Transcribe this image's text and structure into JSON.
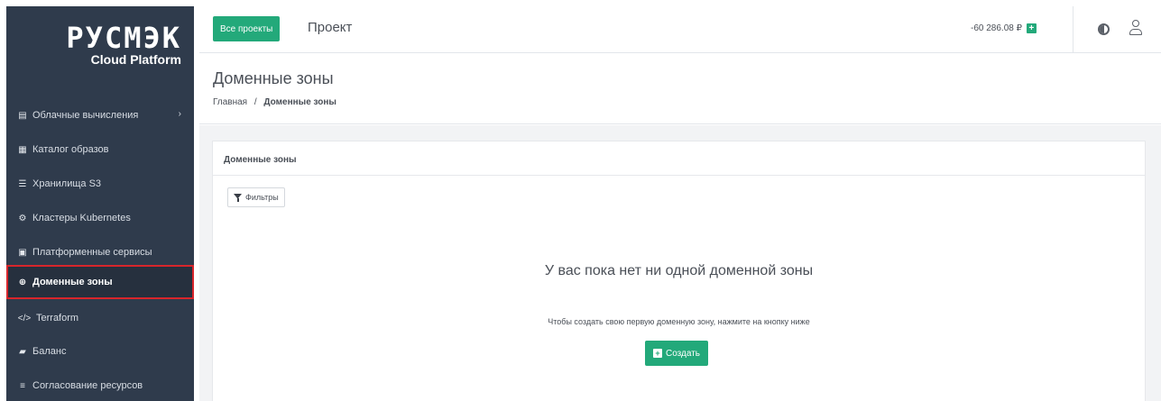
{
  "logo": {
    "main": "РУСМЭК",
    "sub": "Cloud Platform"
  },
  "sidebar": {
    "items": [
      {
        "label": "Облачные вычисления",
        "icon": "server-icon",
        "glyph": "▤",
        "has_arrow": true
      },
      {
        "label": "Каталог образов",
        "icon": "grid-icon",
        "glyph": "▦"
      },
      {
        "label": "Хранилища S3",
        "icon": "database-icon",
        "glyph": "☰"
      },
      {
        "label": "Кластеры Kubernetes",
        "icon": "kubernetes-icon",
        "glyph": "⚙"
      },
      {
        "label": "Платформенные сервисы",
        "icon": "monitor-icon",
        "glyph": "▣"
      },
      {
        "label": "Доменные зоны",
        "icon": "globe-icon",
        "glyph": "⊕",
        "active": true
      },
      {
        "label": "Terraform",
        "icon": "code-icon",
        "glyph": "</>"
      },
      {
        "label": "Баланс",
        "icon": "wallet-icon",
        "glyph": "▰"
      },
      {
        "label": "Согласование ресурсов",
        "icon": "list-icon",
        "glyph": "≡"
      }
    ],
    "arrow": "›"
  },
  "topbar": {
    "projects_button": "Все проекты",
    "project_title": "Проект",
    "balance": "-60 286.08 ₽",
    "add_funds_glyph": "+"
  },
  "page": {
    "title": "Доменные зоны",
    "breadcrumb": {
      "home": "Главная",
      "separator": "/",
      "current": "Доменные зоны"
    }
  },
  "card": {
    "title": "Доменные зоны",
    "filter_button": "Фильтры",
    "empty_title": "У вас пока нет ни одной доменной зоны",
    "empty_desc": "Чтобы создать свою первую доменную зону, нажмите на кнопку ниже",
    "create_button": "Создать",
    "create_glyph": "+"
  },
  "colors": {
    "sidebar_bg": "#2f3b4c",
    "accent_green": "#23a97a",
    "active_border": "#d8252b"
  }
}
